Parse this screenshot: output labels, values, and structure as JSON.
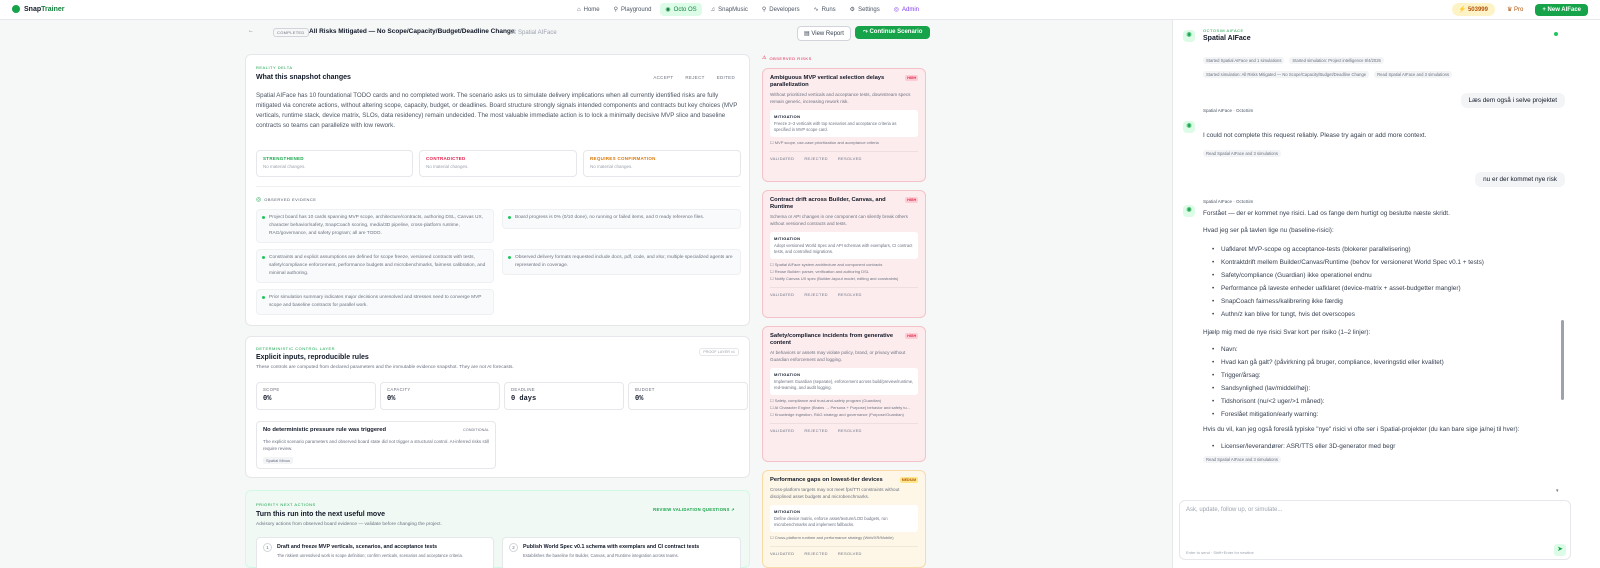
{
  "app": {
    "brand_a": "Snap",
    "brand_b": "Trainer"
  },
  "nav": [
    {
      "icon": "⌂",
      "label": "Home"
    },
    {
      "icon": "⚲",
      "label": "Playground"
    },
    {
      "icon": "◉",
      "label": "Octo OS"
    },
    {
      "icon": "♫",
      "label": "SnapMusic"
    },
    {
      "icon": "⚲",
      "label": "Developers"
    },
    {
      "icon": "∿",
      "label": "Runs"
    },
    {
      "icon": "⚙",
      "label": "Settings"
    },
    {
      "icon": "◎",
      "label": "Admin"
    }
  ],
  "topright": {
    "credits": "503999",
    "pro": "Pro",
    "new": "+ New AIFace"
  },
  "subbar": {
    "back": "←",
    "badge": "COMPLETED",
    "title": "All Risks Mitigated — No Scope/Capacity/Budget/Deadline Change",
    "crumb": "/  ⌘ Spatial AIFace",
    "view_report": "View Report",
    "continue": "Continue Scenario"
  },
  "snapshot": {
    "eyebrow": "REALITY DELTA",
    "title": "What this snapshot changes",
    "tabs": [
      "ACCEPT",
      "REJECT",
      "EDITED"
    ],
    "body": "Spatial AIFace has 10 foundational TODO cards and no completed work. The scenario asks us to simulate delivery implications when all currently identified risks are fully mitigated via concrete actions, without altering scope, capacity, budget, or deadlines. Board structure strongly signals intended components and contracts but key choices (MVP verticals, runtime stack, device matrix, SLOs, data residency) remain undecided. The most valuable immediate action is to lock a minimally decisive MVP slice and baseline contracts so teams can parallelize with low rework.",
    "stats": [
      {
        "label": "STRENGTHENED",
        "value": "No material changes.",
        "color": "#16a34a"
      },
      {
        "label": "CONTRADICTED",
        "value": "No material changes.",
        "color": "#e11d48"
      },
      {
        "label": "REQUIRES CONFIRMATION",
        "value": "No material changes.",
        "color": "#d97706"
      }
    ],
    "evidence_title": "OBSERVED EVIDENCE",
    "evidence": [
      "Project board has 10 cards spanning MVP scope, architecture/contracts, authoring DSL, Canvas UX, character behavior/safety, SnapCoach scoring, media/3D pipeline, cross-platform runtime, RAG/governance, and safety program; all are TODO.",
      "Board progress is 0% (0/10 done), no running or failed items, and 0 ready reference files.",
      "Constraints and explicit assumptions are defined for scope freeze, versioned contracts with tests, safety/compliance enforcement, performance budgets and microbenchmarks, fairness calibration, and minimal authoring.",
      "Observed delivery formats requested include docs, pdf, code, and xlsx; multiple specialized agents are represented in coverage.",
      "Prior simulation summary indicates major decisions unresolved and stresses need to converge MVP scope and baseline contracts for parallel work."
    ]
  },
  "control": {
    "eyebrow": "DETERMINISTIC CONTROL LAYER",
    "title": "Explicit inputs, reproducible rules",
    "subtitle": "These controls are computed from declared parameters and the immutable evidence snapshot. They are not AI forecasts.",
    "tag": "PROOF LAYER v1",
    "metrics": [
      {
        "label": "SCOPE",
        "value": "0%"
      },
      {
        "label": "CAPACITY",
        "value": "0%"
      },
      {
        "label": "DEADLINE",
        "value": "0 days"
      },
      {
        "label": "BUDGET",
        "value": "0%"
      }
    ],
    "rule_title": "No deterministic pressure rule was triggered",
    "rule_tag": "CONDITIONAL",
    "rule_body": "The explicit scenario parameters and observed board state did not trigger a structural control. AI-inferred risks still require review.",
    "rule_chip": "Spatial Minus"
  },
  "priority": {
    "eyebrow": "PRIORITY NEXT ACTIONS",
    "title": "Turn this run into the next useful move",
    "subtitle": "Advisory actions from observed board evidence — validate before changing the project.",
    "link": "REVIEW VALIDATION QUESTIONS ↗",
    "actions": [
      {
        "n": "1",
        "title": "Draft and freeze MVP verticals, scenarios, and acceptance tests",
        "desc": "The riskiest unresolved work is scope definition; confirm verticals, scenarios and acceptance criteria."
      },
      {
        "n": "2",
        "title": "Publish World Spec v0.1 schema with exemplars and CI contract tests",
        "desc": "Establishes the baseline for Builder, Canvas, and Runtime integration across teams."
      }
    ]
  },
  "risks_header": "OBSERVED RISKS",
  "risks": [
    {
      "style": "red",
      "sev": "HIGH",
      "title": "Ambiguous MVP vertical selection delays parallelization",
      "desc": "Without prioritized verticals and acceptance tests, downstream specs remain generic, increasing rework risk.",
      "mitigation": "Freeze 2–3 verticals with top scenarios and acceptance criteria as specified in MVP scope card.",
      "checks": [
        "MVP scope, use-case prioritization and acceptance criteria"
      ],
      "actions": [
        "VALIDATED",
        "REJECTED",
        "RESOLVED"
      ]
    },
    {
      "style": "red",
      "sev": "HIGH",
      "title": "Contract drift across Builder, Canvas, and Runtime",
      "desc": "Schema or API changes in one component can silently break others without versioned contracts and tests.",
      "mitigation": "Adopt versioned World Spec and API schemas with exemplars, CI contract tests, and controlled migrations.",
      "checks": [
        "Spatial AIFace system architecture and component contracts",
        "Reuse Builder: parser, verification and authoring DSL",
        "Notify Canvas UX spec (Builder-layout model, editing and constraints)"
      ],
      "actions": [
        "VALIDATED",
        "REJECTED",
        "RESOLVED"
      ]
    },
    {
      "style": "red",
      "sev": "HIGH",
      "title": "Safety/compliance incidents from generative content",
      "desc": "AI behaviors or assets may violate policy, brand, or privacy without Guardian enforcement and logging.",
      "mitigation": "Implement Guardian (separate), enforcement across build/preview/runtime, red-teaming, and audit logging.",
      "checks": [
        "Safety, compliance and trust-and-safety program (Guardian)",
        "AI Character Engine (Brains → Persona + Purpose) behavior and safety tu...",
        "Knowledge ingestion, RAG strategy and governance (Purpose/Guardian)"
      ],
      "actions": [
        "VALIDATED",
        "REJECTED",
        "RESOLVED"
      ]
    },
    {
      "style": "amb",
      "sev": "MEDIUM",
      "title": "Performance gaps on lowest-tier devices",
      "desc": "Cross-platform targets may not meet fps/TTI constraints without disciplined asset budgets and microbenchmarks.",
      "mitigation": "Define device matrix, enforce asset/texture/LOD budgets, run microbenchmarks and implement fallbacks.",
      "checks": [
        "Cross-platform runtime and performance strategy (Web/XR/Mobile)"
      ],
      "actions": [
        "VALIDATED",
        "REJECTED",
        "RESOLVED"
      ]
    }
  ],
  "chat": {
    "header_eyebrow": "OCTOSIM AIFACE",
    "header_title": "Spatial AIFace",
    "pills_top": [
      "Started Spatial AIFace and 1 simulations",
      "Started simulation: Project intelligence 8/4/2026"
    ],
    "pills_top2": [
      "Started simulation: All Risks Mitigated — No Scope/Capacity/Budget/Deadline Change",
      "Read Spatial AIFace and 3 simulations"
    ],
    "user1": "Læs dem også i selve projektet",
    "sender": "Spatial AIFace · OctoSim",
    "reply1": "I could not complete this request reliably. Please try again or add more context.",
    "pill_reply1": "Read Spatial AIFace and 3 simulations",
    "user2": "nu er der kommet nye risk",
    "reply2_intro": "Forstået — der er kommet nye risici. Lad os fange dem hurtigt og beslutte næste skridt.",
    "reply2_h1": "Hvad jeg ser på tavlen lige nu (baseline-risici):",
    "reply2_list1": [
      "Uafklaret MVP-scope og acceptance-tests (blokerer parallelisering)",
      "Kontraktdrift mellem Builder/Canvas/Runtime (behov for versioneret World Spec v0.1 + tests)",
      "Safety/compliance (Guardian) ikke operationel endnu",
      "Performance på laveste enheder uafklaret (device-matrix + asset-budgetter mangler)",
      "SnapCoach fairness/kalibrering ikke færdig",
      "Authn/z kan blive for tungt, hvis det overscopes"
    ],
    "reply2_h2": "Hjælp mig med de nye risici Svar kort per risiko (1–2 linjer):",
    "reply2_list2": [
      "Navn:",
      "Hvad kan gå galt? (påvirkning på bruger, compliance, leveringstid eller kvalitet)",
      "Trigger/årsag:",
      "Sandsynlighed (lav/middel/høj):",
      "Tidshorisont (nu/<2 uger/>1 måned):",
      "Foreslået mitigation/early warning:"
    ],
    "reply2_h3": "Hvis du vil, kan jeg også foreslå typiske \"nye\" risici vi ofte ser i Spatial-projekter (du kan bare sige ja/nej til hver):",
    "reply2_list3": [
      "Licenser/leverandører: ASR/TTS eller 3D-generator med begr"
    ],
    "pill_reply2": "Read Spatial AIFace and 3 simulations",
    "placeholder": "Ask, update, follow up, or simulate...",
    "hint": "Enter to send · Shift+Enter for newline"
  }
}
